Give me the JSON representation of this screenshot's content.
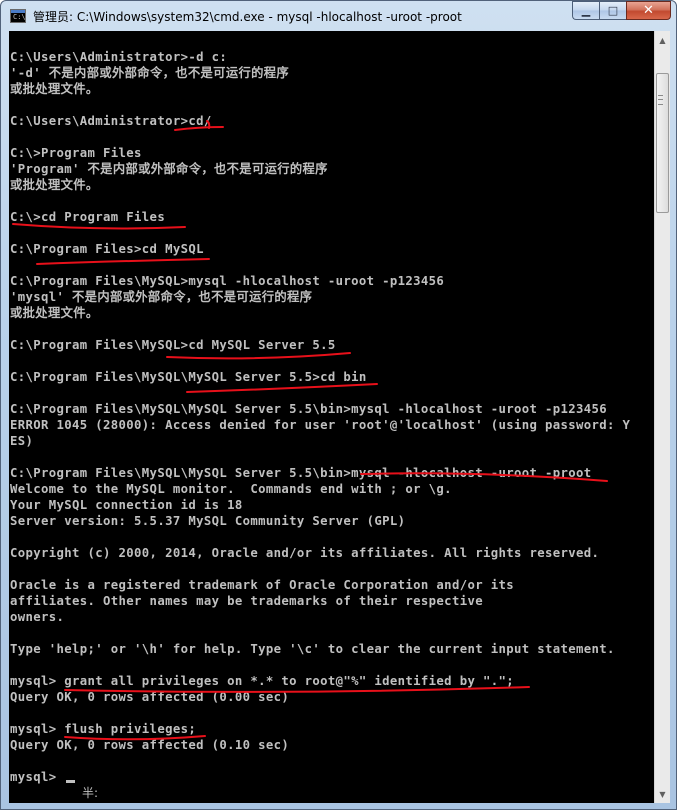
{
  "window": {
    "title": "管理员: C:\\Windows\\system32\\cmd.exe - mysql  -hlocalhost -uroot -proot",
    "icon": "cmd-icon",
    "icon_glyph": "C:\\"
  },
  "caption_buttons": {
    "minimize": "▁",
    "maximize": "□",
    "close": "✕"
  },
  "scrollbar": {
    "up": "▲",
    "down": "▼"
  },
  "console": {
    "lines": [
      "C:\\Users\\Administrator>-d c:",
      "'-d' 不是内部或外部命令，也不是可运行的程序",
      "或批处理文件。",
      "",
      "C:\\Users\\Administrator>cd/",
      "",
      "C:\\>Program Files",
      "'Program' 不是内部或外部命令，也不是可运行的程序",
      "或批处理文件。",
      "",
      "C:\\>cd Program Files",
      "",
      "C:\\Program Files>cd MySQL",
      "",
      "C:\\Program Files\\MySQL>mysql -hlocalhost -uroot -p123456",
      "'mysql' 不是内部或外部命令，也不是可运行的程序",
      "或批处理文件。",
      "",
      "C:\\Program Files\\MySQL>cd MySQL Server 5.5",
      "",
      "C:\\Program Files\\MySQL\\MySQL Server 5.5>cd bin",
      "",
      "C:\\Program Files\\MySQL\\MySQL Server 5.5\\bin>mysql -hlocalhost -uroot -p123456",
      "ERROR 1045 (28000): Access denied for user 'root'@'localhost' (using password: Y",
      "ES)",
      "",
      "C:\\Program Files\\MySQL\\MySQL Server 5.5\\bin>mysql -hlocalhost -uroot -proot",
      "Welcome to the MySQL monitor.  Commands end with ; or \\g.",
      "Your MySQL connection id is 18",
      "Server version: 5.5.37 MySQL Community Server (GPL)",
      "",
      "Copyright (c) 2000, 2014, Oracle and/or its affiliates. All rights reserved.",
      "",
      "Oracle is a registered trademark of Oracle Corporation and/or its",
      "affiliates. Other names may be trademarks of their respective",
      "owners.",
      "",
      "Type 'help;' or '\\h' for help. Type '\\c' to clear the current input statement.",
      "",
      "mysql> grant all privileges on *.* to root@\"%\" identified by \".\";",
      "Query OK, 0 rows affected (0.00 sec)",
      "",
      "mysql> flush privileges;",
      "Query OK, 0 rows affected (0.10 sec)",
      "",
      "mysql> "
    ],
    "ime_indicator": "半:"
  },
  "colors": {
    "console_bg": "#000000",
    "console_text": "#c0c0c0",
    "annotation": "#e8101a"
  }
}
